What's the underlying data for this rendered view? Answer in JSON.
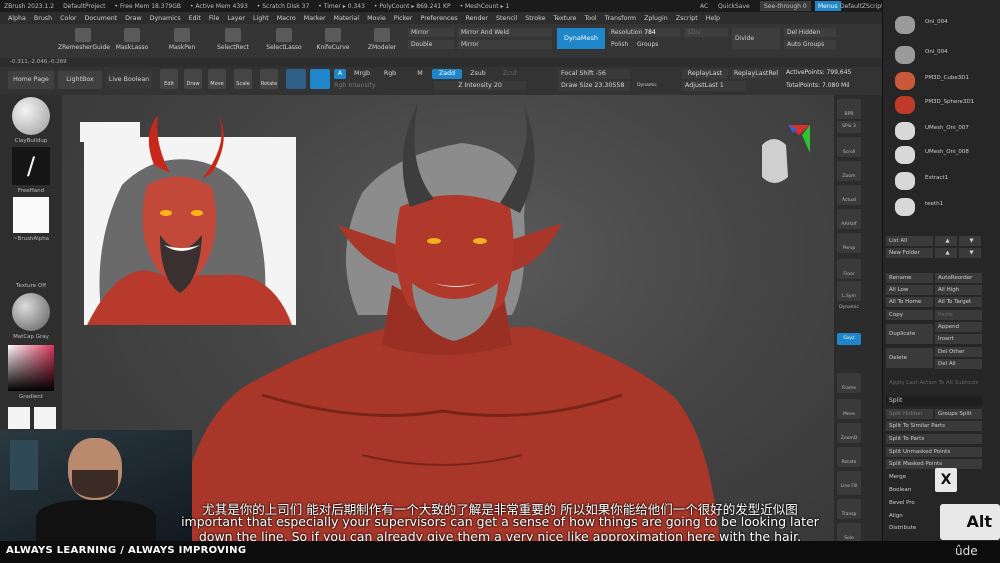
{
  "titlebar": {
    "app": "ZBrush 2023.1.2",
    "project": "DefaultProject",
    "free_mem": "• Free Mem 18.379GB",
    "active_mem": "• Active Mem 4393",
    "scratch": "• Scratch Disk 37",
    "timer": "• Timer ▸ 0.343",
    "polycount": "• PolyCount ▸ 869.241 KP",
    "meshcount": "• MeshCount ▸ 1",
    "ac": "AC",
    "quicksave": "QuickSave",
    "seethrough": "See-through  0",
    "menus": "Menus",
    "defaultzscript": "DefaultZScript"
  },
  "menubar": [
    "Alpha",
    "Brush",
    "Color",
    "Document",
    "Draw",
    "Dynamics",
    "Edit",
    "File",
    "Layer",
    "Light",
    "Macro",
    "Marker",
    "Material",
    "Movie",
    "Picker",
    "Preferences",
    "Render",
    "Stencil",
    "Stroke",
    "Texture",
    "Tool",
    "Transform",
    "Zplugin",
    "Zscript",
    "Help"
  ],
  "shelf": {
    "tools": [
      "ZRemesherGuide",
      "MaskLasso",
      "MaskPen",
      "SelectRect",
      "SelectLasso",
      "KnifeCurve",
      "ZModeler"
    ],
    "mirror": "Mirror",
    "mirror_weld": "Mirror And Weld",
    "double": "Double",
    "mirror2": "Mirror",
    "dynamesh": "DynaMesh",
    "resolution_label": "Resolution",
    "resolution_value": "784",
    "polish": "Polish",
    "groups": "Groups",
    "sdiv": "SDiv",
    "divide": "Divide",
    "del_hidden": "Del Hidden",
    "auto_groups": "Auto Groups"
  },
  "coords": "-0.311,-2.046,-0.269",
  "drawrow": {
    "home": "Home Page",
    "lightbox": "LightBox",
    "live_boolean": "Live Boolean",
    "edit": "Edit",
    "draw": "Draw",
    "move": "Move",
    "scale": "Scale",
    "rotate": "Rotate",
    "a": "A",
    "mrgb": "Mrgb",
    "rgb": "Rgb",
    "m": "M",
    "zadd": "Zadd",
    "zsub": "Zsub",
    "zcut": "Zcut",
    "rgb_intensity": "Rgb Intensity",
    "z_intensity": "Z Intensity 20",
    "focal_shift": "Focal Shift -56",
    "draw_size": "Draw Size 23.30558",
    "dynamic": "Dynamic",
    "replay_last": "ReplayLast",
    "replay_last_rel": "ReplayLastRel",
    "adjust_last": "AdjustLast 1",
    "active_points": "ActivePoints: 799,645",
    "total_points": "TotalPoints: 7.080 Mil"
  },
  "left": {
    "brush1": "ClayBuildup",
    "brush2": "FreeHand",
    "alpha": "~BrushAlpha",
    "texture": "Texture Off",
    "material": "MatCap Gray",
    "gradient": "Gradient"
  },
  "right_shelf": [
    "BPR",
    "SPix 3",
    "Scroll",
    "Zoom",
    "Actual",
    "AAHalf",
    "Persp",
    "Floor",
    "L.Sym",
    "Dynamic",
    "Gxyz",
    "Frame",
    "Move",
    "ZoomD",
    "Rotate",
    "Line Fill",
    "PolyF",
    "Transp",
    "Solo"
  ],
  "subtools": [
    {
      "name": "Oni_004"
    },
    {
      "name": "Oni_004"
    },
    {
      "name": "PM3D_Cube3D1"
    },
    {
      "name": "PM3D_Sphere3D1"
    },
    {
      "name": "UMesh_Oni_007"
    },
    {
      "name": "UMesh_Oni_008"
    },
    {
      "name": "Extract1"
    },
    {
      "name": "teeth1"
    }
  ],
  "subtool_buttons": {
    "list_all": "List All",
    "new_folder": "New Folder",
    "rename": "Rename",
    "autoreorder": "AutoReorder",
    "all_low": "All Low",
    "all_high": "All High",
    "all_to_home": "All To Home",
    "all_to_target": "All To Target",
    "copy": "Copy",
    "paste": "Paste",
    "append": "Append",
    "duplicate": "Duplicate",
    "insert": "Insert",
    "delete": "Delete",
    "del_other": "Del Other",
    "del_all": "Del All",
    "apply_last": "Apply Last Action To All Subtools",
    "split": "Split",
    "split_hidden": "Split Hidden",
    "groups_split": "Groups Split",
    "split_similar": "Split To Similar Parts",
    "split_parts": "Split To Parts",
    "split_unmasked": "Split Unmasked Points",
    "split_masked": "Split Masked Points",
    "merge": "Merge",
    "boolean": "Boolean",
    "bevel_pro": "Bevel Pro",
    "align": "Align",
    "distribute": "Distribute"
  },
  "overlay": {
    "x_key": "X",
    "alt_key": "Alt"
  },
  "subtitles": {
    "chinese": "尤其是你的上司们 能对后期制作有一个大致的了解是非常重要的 所以如果你能给他们一个很好的发型近似图",
    "line1": "important that especially your supervisors can get a sense of how things are going to be looking later",
    "line2": "down the line. So if you can already give them a very nice like approximation here with the hair."
  },
  "footer": {
    "tagline": "ALWAYS LEARNING / ALWAYS IMPROVING",
    "brand": "ûde"
  },
  "colors": {
    "accent": "#1f86c9",
    "skin": "#a8372a",
    "horn": "#3d3d3d"
  }
}
